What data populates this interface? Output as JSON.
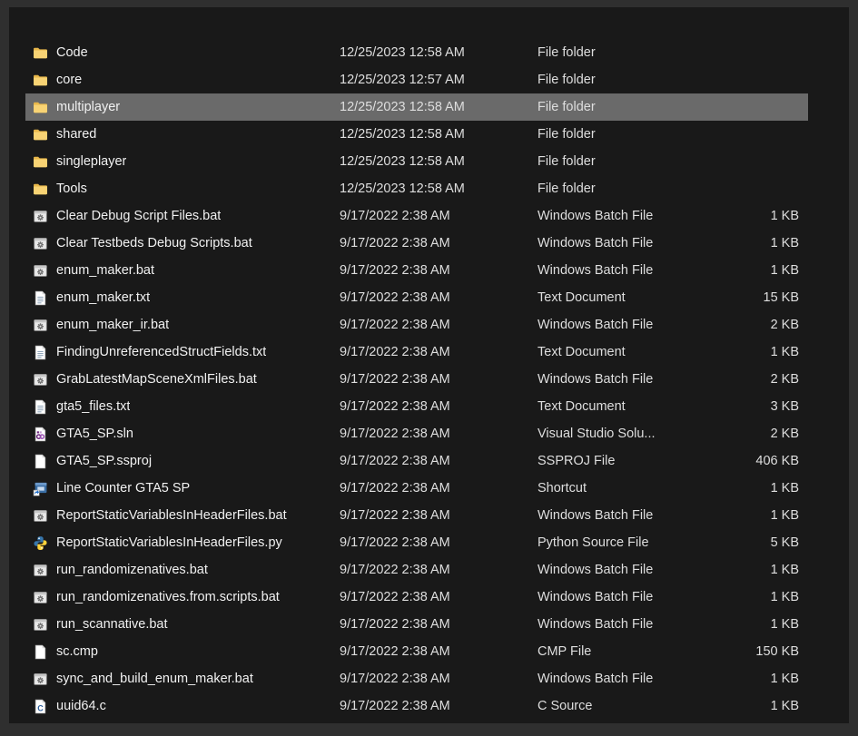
{
  "colors": {
    "panel_background": "#191919",
    "frame_background": "#2f2f2f",
    "selection_background": "#6a6a6a",
    "folder_yellow": "#f8d374"
  },
  "file_list": {
    "rows": [
      {
        "name": "Code",
        "date": "12/25/2023 12:58 AM",
        "type": "File folder",
        "size": "",
        "icon": "folder-icon",
        "selected": false
      },
      {
        "name": "core",
        "date": "12/25/2023 12:57 AM",
        "type": "File folder",
        "size": "",
        "icon": "folder-icon",
        "selected": false
      },
      {
        "name": "multiplayer",
        "date": "12/25/2023 12:58 AM",
        "type": "File folder",
        "size": "",
        "icon": "folder-icon",
        "selected": true
      },
      {
        "name": "shared",
        "date": "12/25/2023 12:58 AM",
        "type": "File folder",
        "size": "",
        "icon": "folder-icon",
        "selected": false
      },
      {
        "name": "singleplayer",
        "date": "12/25/2023 12:58 AM",
        "type": "File folder",
        "size": "",
        "icon": "folder-icon",
        "selected": false
      },
      {
        "name": "Tools",
        "date": "12/25/2023 12:58 AM",
        "type": "File folder",
        "size": "",
        "icon": "folder-icon",
        "selected": false
      },
      {
        "name": "Clear Debug Script Files.bat",
        "date": "9/17/2022 2:38 AM",
        "type": "Windows Batch File",
        "size": "1 KB",
        "icon": "batch-file-icon",
        "selected": false
      },
      {
        "name": "Clear Testbeds Debug Scripts.bat",
        "date": "9/17/2022 2:38 AM",
        "type": "Windows Batch File",
        "size": "1 KB",
        "icon": "batch-file-icon",
        "selected": false
      },
      {
        "name": "enum_maker.bat",
        "date": "9/17/2022 2:38 AM",
        "type": "Windows Batch File",
        "size": "1 KB",
        "icon": "batch-file-icon",
        "selected": false
      },
      {
        "name": "enum_maker.txt",
        "date": "9/17/2022 2:38 AM",
        "type": "Text Document",
        "size": "15 KB",
        "icon": "text-document-icon",
        "selected": false
      },
      {
        "name": "enum_maker_ir.bat",
        "date": "9/17/2022 2:38 AM",
        "type": "Windows Batch File",
        "size": "2 KB",
        "icon": "batch-file-icon",
        "selected": false
      },
      {
        "name": "FindingUnreferencedStructFields.txt",
        "date": "9/17/2022 2:38 AM",
        "type": "Text Document",
        "size": "1 KB",
        "icon": "text-document-icon",
        "selected": false
      },
      {
        "name": "GrabLatestMapSceneXmlFiles.bat",
        "date": "9/17/2022 2:38 AM",
        "type": "Windows Batch File",
        "size": "2 KB",
        "icon": "batch-file-icon",
        "selected": false
      },
      {
        "name": "gta5_files.txt",
        "date": "9/17/2022 2:38 AM",
        "type": "Text Document",
        "size": "3 KB",
        "icon": "text-document-icon",
        "selected": false
      },
      {
        "name": "GTA5_SP.sln",
        "date": "9/17/2022 2:38 AM",
        "type": "Visual Studio Solu...",
        "size": "2 KB",
        "icon": "vs-solution-icon",
        "selected": false
      },
      {
        "name": "GTA5_SP.ssproj",
        "date": "9/17/2022 2:38 AM",
        "type": "SSPROJ File",
        "size": "406 KB",
        "icon": "blank-file-icon",
        "selected": false
      },
      {
        "name": "Line Counter GTA5 SP",
        "date": "9/17/2022 2:38 AM",
        "type": "Shortcut",
        "size": "1 KB",
        "icon": "shortcut-icon",
        "selected": false
      },
      {
        "name": "ReportStaticVariablesInHeaderFiles.bat",
        "date": "9/17/2022 2:38 AM",
        "type": "Windows Batch File",
        "size": "1 KB",
        "icon": "batch-file-icon",
        "selected": false
      },
      {
        "name": "ReportStaticVariablesInHeaderFiles.py",
        "date": "9/17/2022 2:38 AM",
        "type": "Python Source File",
        "size": "5 KB",
        "icon": "python-file-icon",
        "selected": false
      },
      {
        "name": "run_randomizenatives.bat",
        "date": "9/17/2022 2:38 AM",
        "type": "Windows Batch File",
        "size": "1 KB",
        "icon": "batch-file-icon",
        "selected": false
      },
      {
        "name": "run_randomizenatives.from.scripts.bat",
        "date": "9/17/2022 2:38 AM",
        "type": "Windows Batch File",
        "size": "1 KB",
        "icon": "batch-file-icon",
        "selected": false
      },
      {
        "name": "run_scannative.bat",
        "date": "9/17/2022 2:38 AM",
        "type": "Windows Batch File",
        "size": "1 KB",
        "icon": "batch-file-icon",
        "selected": false
      },
      {
        "name": "sc.cmp",
        "date": "9/17/2022 2:38 AM",
        "type": "CMP File",
        "size": "150 KB",
        "icon": "blank-file-icon",
        "selected": false
      },
      {
        "name": "sync_and_build_enum_maker.bat",
        "date": "9/17/2022 2:38 AM",
        "type": "Windows Batch File",
        "size": "1 KB",
        "icon": "batch-file-icon",
        "selected": false
      },
      {
        "name": "uuid64.c",
        "date": "9/17/2022 2:38 AM",
        "type": "C Source",
        "size": "1 KB",
        "icon": "c-source-icon",
        "selected": false
      }
    ]
  }
}
